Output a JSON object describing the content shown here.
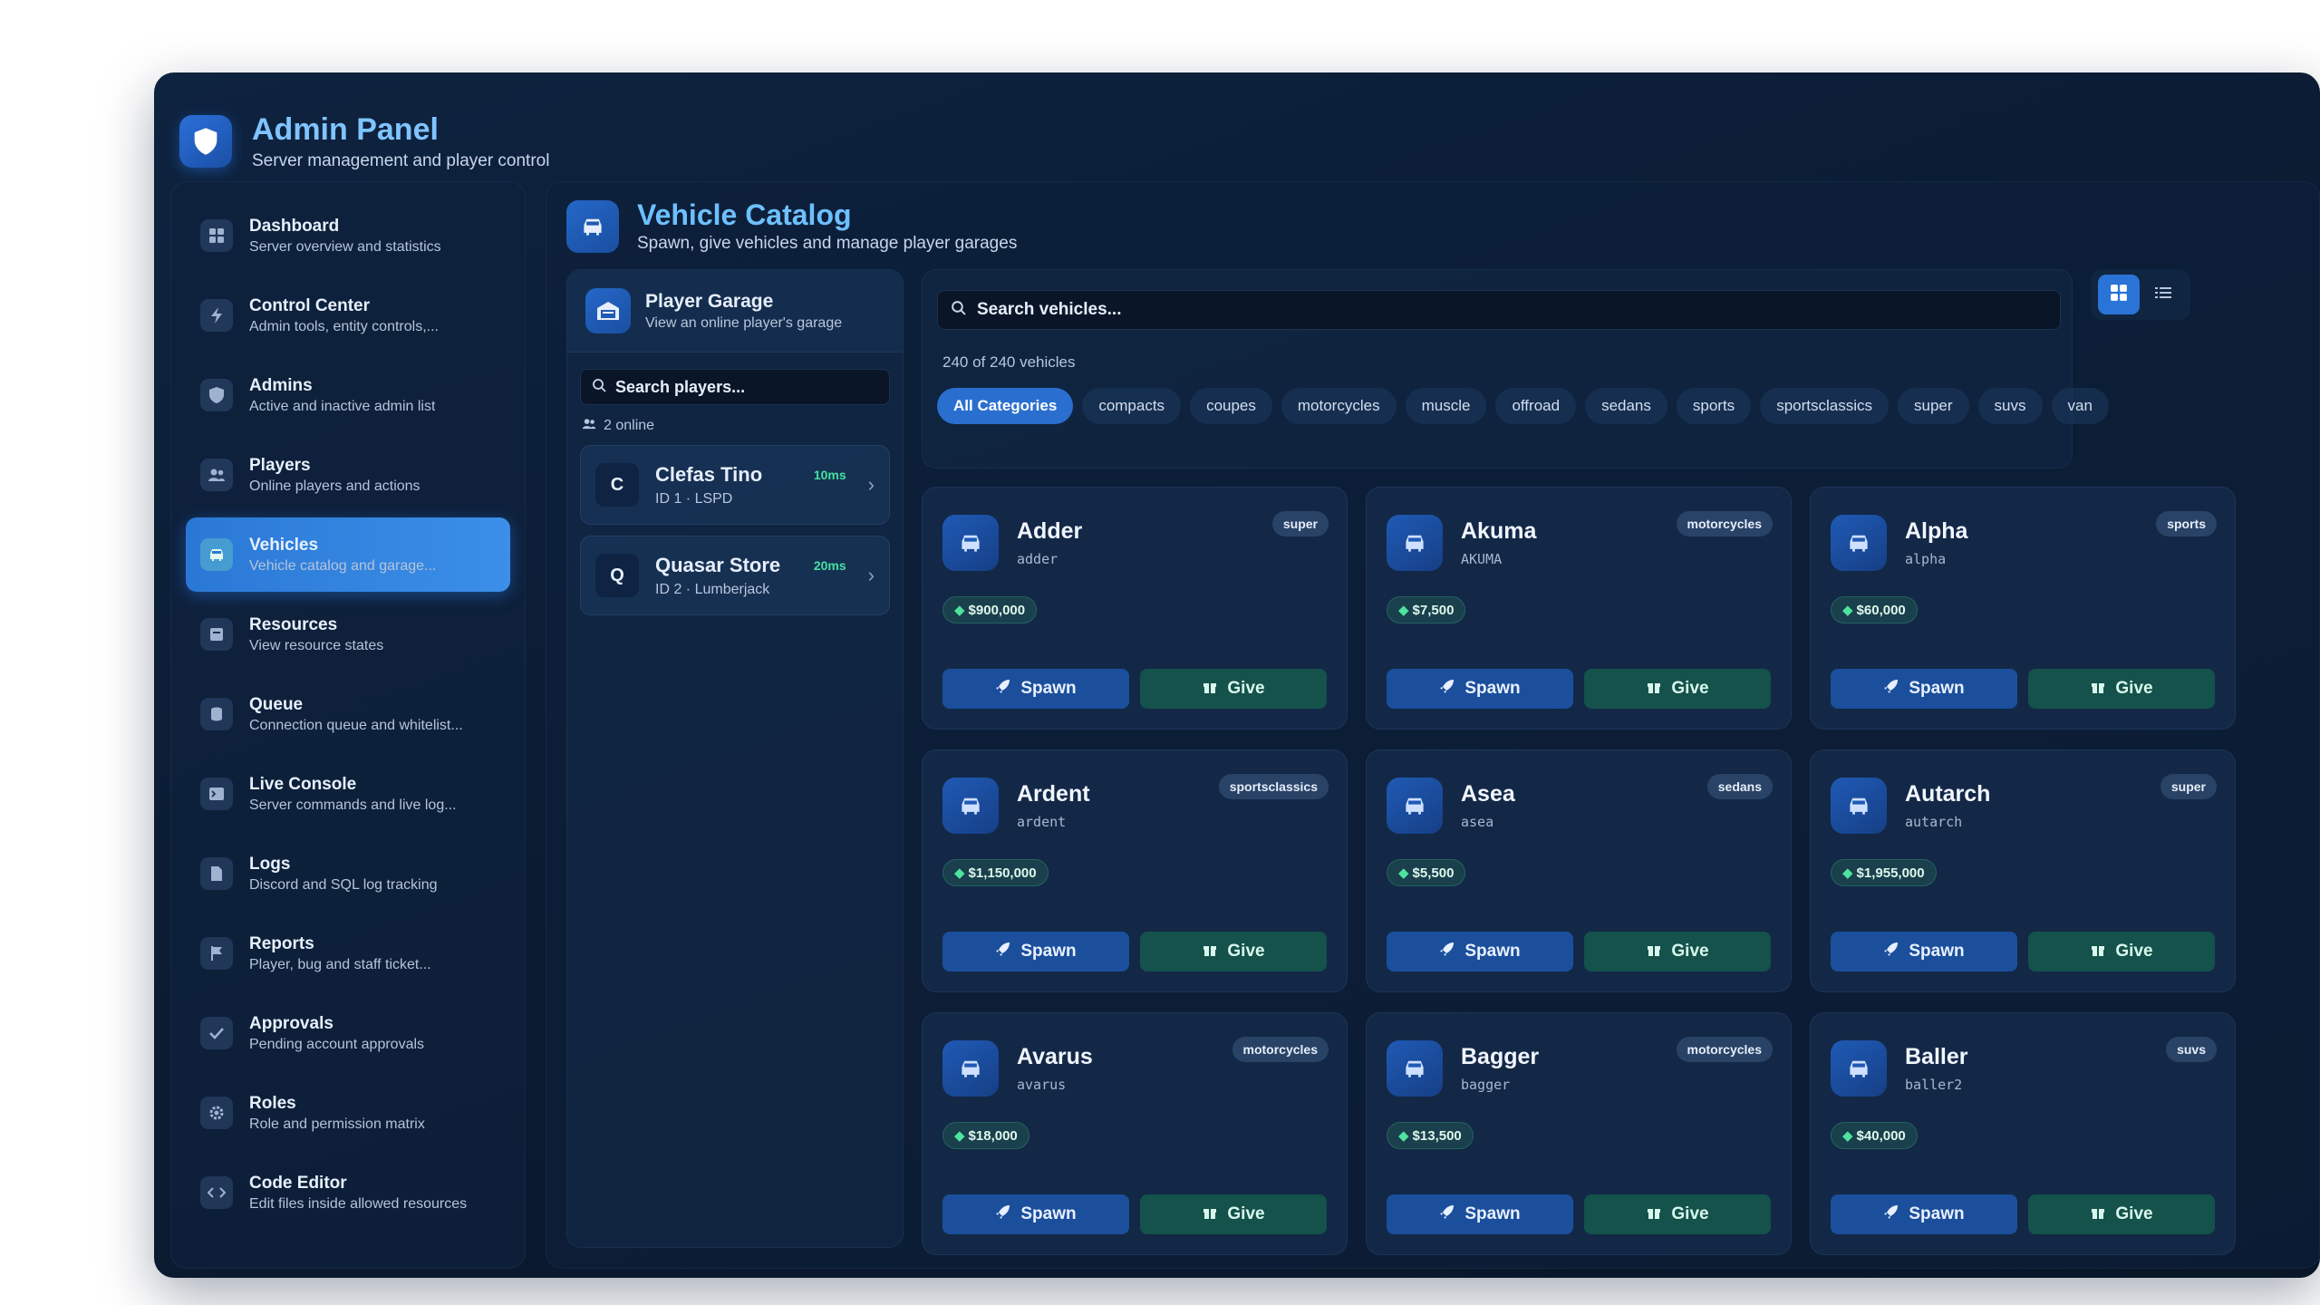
{
  "app": {
    "title": "Admin Panel",
    "subtitle": "Server management and player control",
    "colors": {
      "accent": "#2a74d8",
      "success": "#45e0a0",
      "background": "#0a1a30"
    }
  },
  "sidebar": {
    "items": [
      {
        "title": "Dashboard",
        "desc": "Server overview and statistics",
        "icon": "grid-icon"
      },
      {
        "title": "Control Center",
        "desc": "Admin tools, entity controls,...",
        "icon": "bolt-icon"
      },
      {
        "title": "Admins",
        "desc": "Active and inactive admin list",
        "icon": "shield-icon"
      },
      {
        "title": "Players",
        "desc": "Online players and actions",
        "icon": "users-icon"
      },
      {
        "title": "Vehicles",
        "desc": "Vehicle catalog and garage...",
        "icon": "car-icon"
      },
      {
        "title": "Resources",
        "desc": "View resource states",
        "icon": "box-icon"
      },
      {
        "title": "Queue",
        "desc": "Connection queue and whitelist...",
        "icon": "queue-icon"
      },
      {
        "title": "Live Console",
        "desc": "Server commands and live log...",
        "icon": "terminal-icon"
      },
      {
        "title": "Logs",
        "desc": "Discord and SQL log tracking",
        "icon": "file-icon"
      },
      {
        "title": "Reports",
        "desc": "Player, bug and staff ticket...",
        "icon": "flag-icon"
      },
      {
        "title": "Approvals",
        "desc": "Pending account approvals",
        "icon": "check-icon"
      },
      {
        "title": "Roles",
        "desc": "Role and permission matrix",
        "icon": "gear-icon"
      },
      {
        "title": "Code Editor",
        "desc": "Edit files inside allowed resources",
        "icon": "code-icon"
      }
    ]
  },
  "main": {
    "title": "Vehicle Catalog",
    "subtitle": "Spawn, give vehicles and manage player garages"
  },
  "garage": {
    "title": "Player Garage",
    "subtitle": "View an online player's garage",
    "search_placeholder": "Search players...",
    "online_label": "2 online",
    "players": [
      {
        "initial": "C",
        "name": "Clefas Tino",
        "id": "ID 1 · LSPD",
        "ping": "10ms"
      },
      {
        "initial": "Q",
        "name": "Quasar Store",
        "id": "ID 2 · Lumberjack",
        "ping": "20ms"
      }
    ]
  },
  "catalog": {
    "search_placeholder": "Search vehicles...",
    "count_label": "240 of 240 vehicles",
    "categories": [
      "All Categories",
      "compacts",
      "coupes",
      "motorcycles",
      "muscle",
      "offroad",
      "sedans",
      "sports",
      "sportsclassics",
      "super",
      "suvs",
      "van"
    ],
    "spawn_label": "Spawn",
    "give_label": "Give",
    "vehicles": [
      {
        "name": "Adder",
        "model": "adder",
        "class": "super",
        "price": "$900,000"
      },
      {
        "name": "Akuma",
        "model": "AKUMA",
        "class": "motorcycles",
        "price": "$7,500"
      },
      {
        "name": "Alpha",
        "model": "alpha",
        "class": "sports",
        "price": "$60,000"
      },
      {
        "name": "Ardent",
        "model": "ardent",
        "class": "sportsclassics",
        "price": "$1,150,000"
      },
      {
        "name": "Asea",
        "model": "asea",
        "class": "sedans",
        "price": "$5,500"
      },
      {
        "name": "Autarch",
        "model": "autarch",
        "class": "super",
        "price": "$1,955,000"
      },
      {
        "name": "Avarus",
        "model": "avarus",
        "class": "motorcycles",
        "price": "$18,000"
      },
      {
        "name": "Bagger",
        "model": "bagger",
        "class": "motorcycles",
        "price": "$13,500"
      },
      {
        "name": "Baller",
        "model": "baller2",
        "class": "suvs",
        "price": "$40,000"
      }
    ]
  }
}
